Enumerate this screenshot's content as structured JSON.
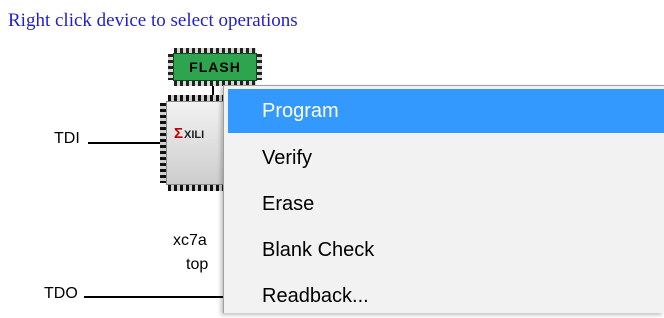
{
  "hint": "Right click device to select operations",
  "chain": {
    "tdi_label": "TDI",
    "tdo_label": "TDO"
  },
  "flash_chip": {
    "label": "FLASH",
    "color": "#2ea44f"
  },
  "fpga_chip": {
    "logo_text": "XILI",
    "logo_icon": "xilinx-sigma-icon"
  },
  "device": {
    "name": "xc7a",
    "file": "top"
  },
  "context_menu": {
    "items": [
      {
        "label": "Program",
        "selected": true
      },
      {
        "label": "Verify",
        "selected": false
      },
      {
        "label": "Erase",
        "selected": false
      },
      {
        "label": "Blank Check",
        "selected": false
      },
      {
        "label": "Readback...",
        "selected": false
      }
    ],
    "highlight_color": "#3399ff"
  },
  "hint_color": "#1f1fd0"
}
